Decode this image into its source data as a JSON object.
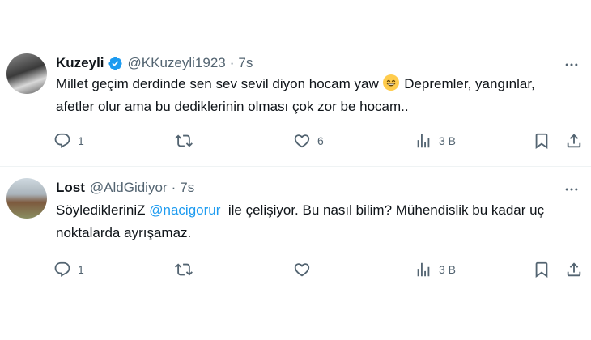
{
  "tweets": [
    {
      "name": "Kuzeyli",
      "handle": "@KKuzeyli1923",
      "separator": "·",
      "time": "7s",
      "verified": true,
      "text_parts": [
        "Millet geçim derdinde sen sev sevil diyon hocam yaw ",
        " Depremler, yangınlar, afetler olur ama bu dediklerinin olması çok zor be hocam.."
      ],
      "emoji": "grinning-face-with-smiling-eyes",
      "replies": "1",
      "retweets": "",
      "likes": "6",
      "views": "3 B"
    },
    {
      "name": "Lost",
      "handle": "@AldGidiyor",
      "separator": "·",
      "time": "7s",
      "verified": false,
      "text_parts": [
        "SöyledikleriniZ ",
        "@nacigorur",
        "  ile çelişiyor. Bu nasıl bilim? Mühendislik bu kadar uç noktalarda ayrışamaz."
      ],
      "replies": "1",
      "retweets": "",
      "likes": "",
      "views": "3 B"
    }
  ],
  "colors": {
    "text": "#0f1419",
    "secondary": "#536471",
    "accent": "#1d9bf0",
    "divider": "#eff3f4"
  },
  "icons": [
    "verified-badge-icon",
    "more-icon",
    "reply-icon",
    "retweet-icon",
    "like-icon",
    "views-icon",
    "bookmark-icon",
    "share-icon"
  ]
}
